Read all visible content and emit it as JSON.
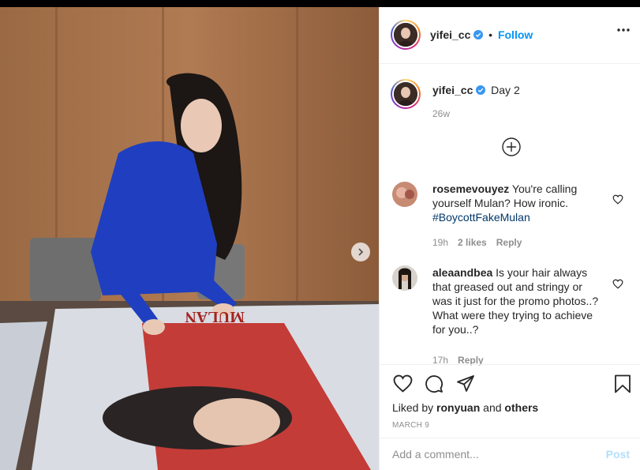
{
  "post": {
    "author": {
      "username": "yifei_cc",
      "follow_label": "Follow",
      "separator": "•"
    },
    "caption": {
      "username": "yifei_cc",
      "text": "Day 2",
      "age": "26w"
    },
    "comments": [
      {
        "username": "rosemevouyez",
        "text": "You're calling yourself Mulan? How ironic.",
        "hashtag": "#BoycottFakeMulan",
        "age": "19h",
        "likes": "2 likes",
        "reply_label": "Reply"
      },
      {
        "username": "aleaandbea",
        "text": "Is your hair always that greased out and stringy or was it just for the promo photos..? What were they trying to achieve for you..?",
        "age": "17h",
        "reply_label": "Reply"
      }
    ],
    "liked_by": {
      "prefix": "Liked by",
      "user": "ronyuan",
      "joiner": "and",
      "others": "others"
    },
    "date": "MARCH 9",
    "comment_input": {
      "placeholder": "Add a comment..."
    },
    "post_label": "Post",
    "carousel": {
      "slides": 3,
      "active": 0
    },
    "poster_text": "MULAN"
  },
  "colors": {
    "follow_blue": "#0095f6",
    "verified_blue": "#3897f0",
    "hashtag": "#00376b",
    "muted": "#8e8e8e",
    "post_disabled": "#b2dffc"
  },
  "icons": [
    "verified-badge-icon",
    "more-options-icon",
    "load-more-comments-icon",
    "heart-icon",
    "comment-icon",
    "share-icon",
    "bookmark-icon",
    "chevron-right-icon"
  ]
}
